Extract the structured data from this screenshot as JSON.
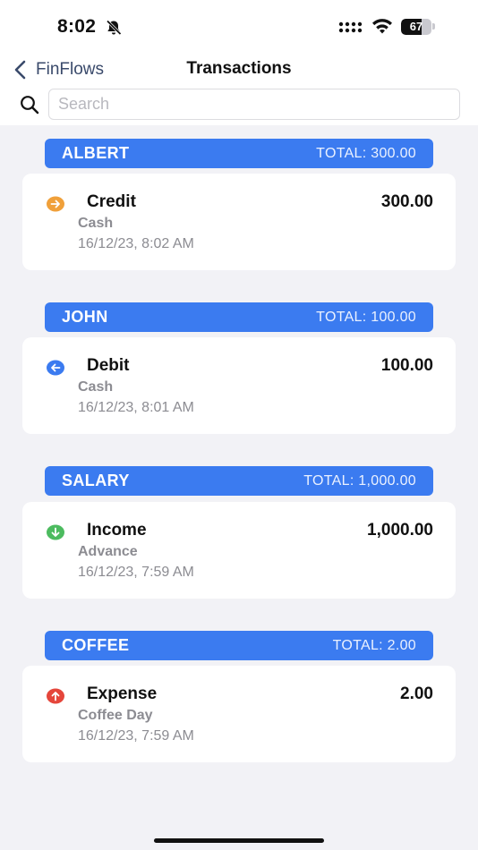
{
  "status_bar": {
    "time": "8:02",
    "battery": "67",
    "battery_level": 0.67
  },
  "nav": {
    "back_label": "FinFlows",
    "title": "Transactions"
  },
  "search": {
    "placeholder": "Search",
    "value": ""
  },
  "colors": {
    "header_blue": "#3b7bf0",
    "credit": "#f0a03a",
    "debit": "#3b7bf0",
    "income": "#4cbb5f",
    "expense": "#e5463b"
  },
  "groups": [
    {
      "name": "ALBERT",
      "total": "TOTAL: 300.00",
      "transaction": {
        "icon": "arrow-right-circle-icon",
        "type": "Credit",
        "amount": "300.00",
        "account": "Cash",
        "date": "16/12/23, 8:02 AM"
      }
    },
    {
      "name": "JOHN",
      "total": "TOTAL: 100.00",
      "transaction": {
        "icon": "arrow-left-circle-icon",
        "type": "Debit",
        "amount": "100.00",
        "account": "Cash",
        "date": "16/12/23, 8:01 AM"
      }
    },
    {
      "name": "SALARY",
      "total": "TOTAL: 1,000.00",
      "transaction": {
        "icon": "arrow-down-circle-icon",
        "type": "Income",
        "amount": "1,000.00",
        "account": "Advance",
        "date": "16/12/23, 7:59 AM"
      }
    },
    {
      "name": "COFFEE",
      "total": "TOTAL: 2.00",
      "transaction": {
        "icon": "arrow-up-circle-icon",
        "type": "Expense",
        "amount": "2.00",
        "account": "Coffee Day",
        "date": "16/12/23, 7:59 AM"
      }
    }
  ]
}
